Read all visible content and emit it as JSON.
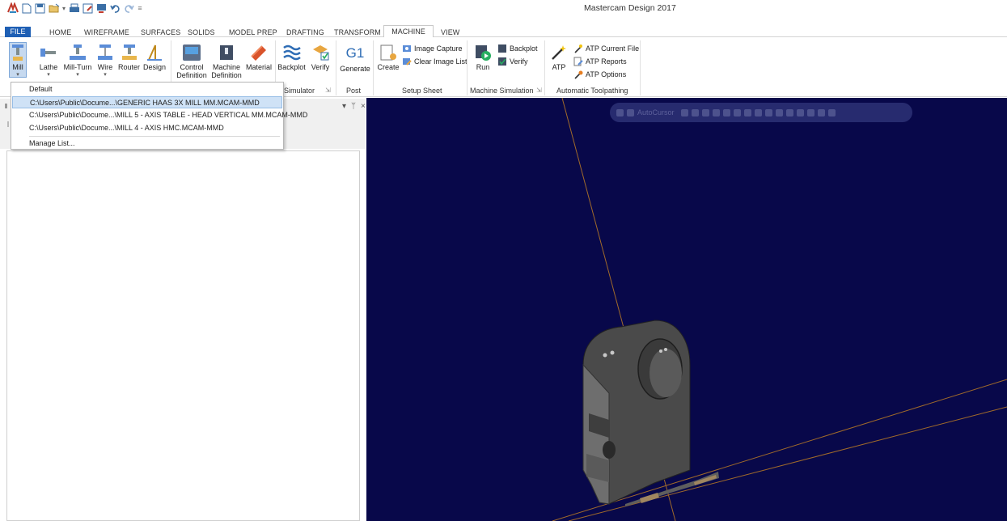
{
  "app": {
    "title": "Mastercam Design 2017"
  },
  "qat": {
    "icons": [
      "mastercam-logo-icon",
      "new-icon",
      "save-icon",
      "open-icon",
      "print-icon",
      "save-as-icon",
      "screen-icon",
      "undo-icon",
      "redo-icon",
      "customize-icon"
    ]
  },
  "tabs": {
    "file": "FILE",
    "items": [
      "HOME",
      "WIREFRAME",
      "SURFACES",
      "SOLIDS",
      "MODEL PREP",
      "DRAFTING",
      "TRANSFORM",
      "MACHINE",
      "VIEW"
    ],
    "active": "MACHINE"
  },
  "ribbon": {
    "machine_type": {
      "mill": "Mill",
      "lathe": "Lathe",
      "mill_turn": "Mill-Turn",
      "wire": "Wire",
      "router": "Router",
      "design": "Design"
    },
    "machine_setup": {
      "control": "Control",
      "control2": "Definition",
      "machine": "Machine",
      "machine2": "Definition",
      "material": "Material"
    },
    "simulator": {
      "backplot": "Backplot",
      "verify": "Verify",
      "label": "Simulator"
    },
    "post": {
      "generate": "Generate",
      "label": "Post",
      "g1": "G1"
    },
    "setup_sheet": {
      "create": "Create",
      "image_capture": "Image Capture",
      "clear_image_list": "Clear Image List",
      "label": "Setup Sheet"
    },
    "machine_simulation": {
      "run": "Run",
      "backplot": "Backplot",
      "verify": "Verify",
      "label": "Machine Simulation"
    },
    "atp": {
      "atp": "ATP",
      "current_file": "ATP Current File",
      "reports": "ATP Reports",
      "options": "ATP Options",
      "label": "Automatic Toolpathing"
    }
  },
  "dropdown": {
    "items": [
      "Default",
      "C:\\Users\\Public\\Docume...\\GENERIC HAAS 3X MILL MM.MCAM-MMD",
      "C:\\Users\\Public\\Docume...\\MILL 5 - AXIS TABLE - HEAD VERTICAL MM.MCAM-MMD",
      "C:\\Users\\Public\\Docume...\\MILL 4 - AXIS HMC.MCAM-MMD",
      "Manage List..."
    ],
    "selected_index": 1
  },
  "pane": {
    "controls": [
      "▾",
      "ᛘ",
      "×"
    ]
  },
  "autocursor": {
    "label": "AutoCursor"
  },
  "colors": {
    "file_tab": "#1e5fb4",
    "viewport_bg": "#08084a",
    "selection": "#cfe2f6"
  }
}
